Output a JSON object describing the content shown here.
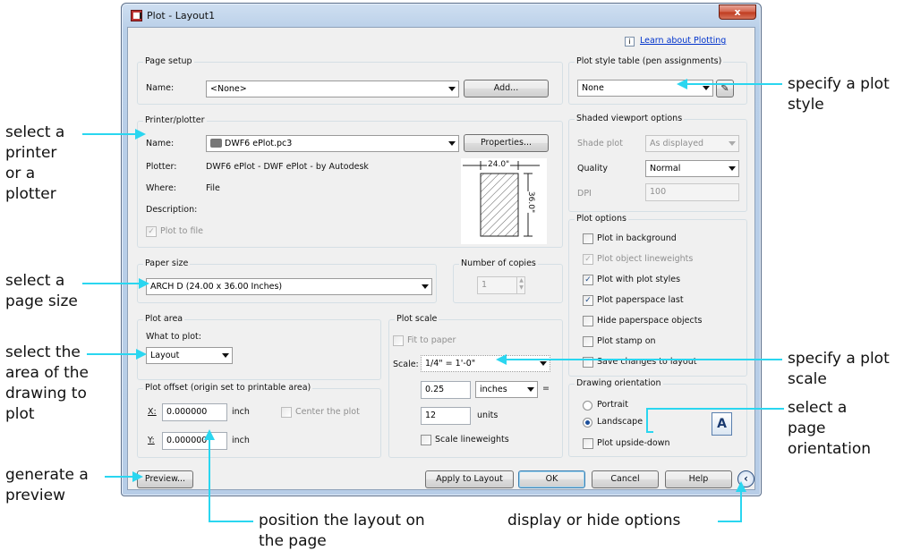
{
  "window": {
    "title": "Plot - Layout1",
    "close": "x"
  },
  "help_link": {
    "icon": "i",
    "text": "Learn about Plotting"
  },
  "page_setup": {
    "title": "Page setup",
    "name_label": "Name:",
    "name_value": "<None>",
    "add_button": "Add..."
  },
  "printer": {
    "title": "Printer/plotter",
    "name_label": "Name:",
    "name_value": "DWF6 ePlot.pc3",
    "properties_button": "Properties...",
    "plotter_label": "Plotter:",
    "plotter_value": "DWF6 ePlot - DWF ePlot - by Autodesk",
    "where_label": "Where:",
    "where_value": "File",
    "description_label": "Description:",
    "plot_to_file": "Plot to file",
    "preview_width": "24.0\"",
    "preview_height": "36.0\""
  },
  "paper_size": {
    "title": "Paper size",
    "value": "ARCH D (24.00 x 36.00 Inches)"
  },
  "copies": {
    "title": "Number of copies",
    "value": "1"
  },
  "plot_area": {
    "title": "Plot area",
    "what_label": "What to plot:",
    "value": "Layout"
  },
  "plot_offset": {
    "title": "Plot offset (origin set to printable area)",
    "x_label": "X:",
    "x_value": "0.000000",
    "y_label": "Y:",
    "y_value": "0.000000",
    "unit": "inch",
    "center": "Center the plot"
  },
  "plot_scale": {
    "title": "Plot scale",
    "fit": "Fit to paper",
    "scale_label": "Scale:",
    "scale_value": "1/4\" = 1'-0\"",
    "v1": "0.25",
    "u1": "inches",
    "eq": "=",
    "v2": "12",
    "u2": "units",
    "lineweights": "Scale lineweights"
  },
  "style_table": {
    "title": "Plot style table (pen assignments)",
    "value": "None"
  },
  "shaded": {
    "title": "Shaded viewport options",
    "shade_label": "Shade plot",
    "shade_value": "As displayed",
    "quality_label": "Quality",
    "quality_value": "Normal",
    "dpi_label": "DPI",
    "dpi_value": "100"
  },
  "plot_options": {
    "title": "Plot options",
    "items": [
      "Plot in background",
      "Plot object lineweights",
      "Plot with plot styles",
      "Plot paperspace last",
      "Hide paperspace objects",
      "Plot stamp on",
      "Save changes to layout"
    ]
  },
  "orientation": {
    "title": "Drawing orientation",
    "portrait": "Portrait",
    "landscape": "Landscape",
    "upside": "Plot upside-down",
    "icon": "A"
  },
  "buttons": {
    "preview": "Preview...",
    "apply": "Apply to Layout",
    "ok": "OK",
    "cancel": "Cancel",
    "help": "Help"
  },
  "annotations": {
    "printer": [
      "select a",
      "printer",
      "or a",
      "plotter"
    ],
    "page_size": [
      "select a",
      "page size"
    ],
    "area": [
      "select the",
      "area of the",
      "drawing to",
      "plot"
    ],
    "preview": [
      "generate a",
      "preview"
    ],
    "position": [
      "position the layout on",
      "the page"
    ],
    "display": "display or hide options",
    "style": [
      "specify a plot",
      "style"
    ],
    "scale": [
      "specify a plot",
      "scale"
    ],
    "orientation": [
      "select a",
      "page",
      "orientation"
    ]
  },
  "colors": {
    "callout": "#2ad6f0",
    "link": "#0033cc"
  }
}
